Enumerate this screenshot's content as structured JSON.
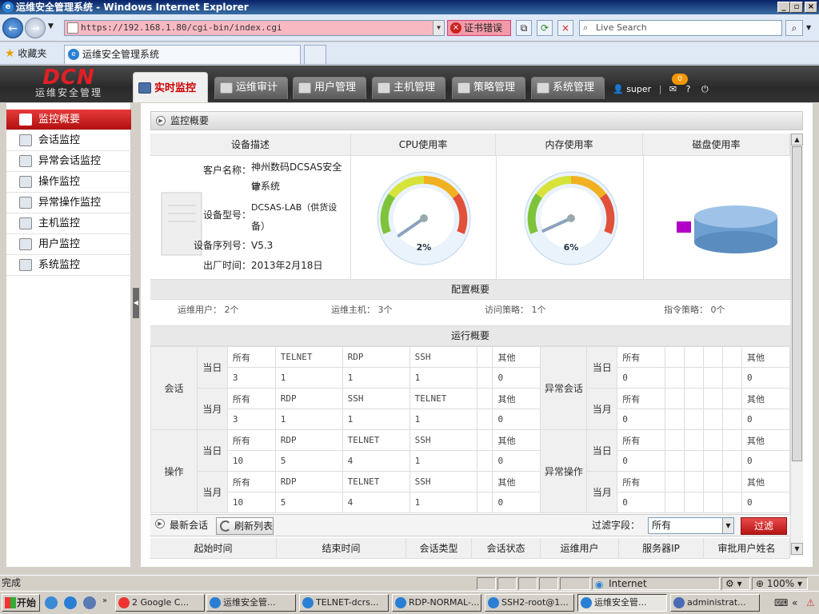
{
  "window": {
    "title": "运维安全管理系统 - Windows Internet Explorer"
  },
  "browser": {
    "address": "https://192.168.1.80/cgi-bin/index.cgi",
    "cert_error": "证书错误",
    "search_placeholder": "Live Search",
    "favorites": "收藏夹",
    "tab_title": "运维安全管理系统"
  },
  "app": {
    "logo_main": "DCN",
    "logo_sub": "运维安全管理",
    "tabs": [
      {
        "label": "实时监控"
      },
      {
        "label": "运维审计"
      },
      {
        "label": "用户管理"
      },
      {
        "label": "主机管理"
      },
      {
        "label": "策略管理"
      },
      {
        "label": "系统管理"
      }
    ],
    "user": "super",
    "message_count": "0",
    "help": "?",
    "logout": "⏻"
  },
  "sidebar": {
    "items": [
      {
        "label": "监控概要",
        "icon": "overview-icon"
      },
      {
        "label": "会话监控",
        "icon": "session-icon"
      },
      {
        "label": "异常会话监控",
        "icon": "alert-session-icon"
      },
      {
        "label": "操作监控",
        "icon": "operation-icon"
      },
      {
        "label": "异常操作监控",
        "icon": "alert-operation-icon"
      },
      {
        "label": "主机监控",
        "icon": "host-icon"
      },
      {
        "label": "用户监控",
        "icon": "user-icon"
      },
      {
        "label": "系统监控",
        "icon": "system-icon"
      }
    ]
  },
  "main": {
    "breadcrumb": "监控概要",
    "headers": {
      "device": "设备描述",
      "cpu": "CPU使用率",
      "mem": "内存使用率",
      "disk": "磁盘使用率"
    },
    "device": {
      "customer_label": "客户名称：",
      "customer_line1": "神州数码DCSAS安全审",
      "customer_line2": "计系统",
      "model_label": "设备型号：",
      "model_line1": "DCSAS-LAB（供货设",
      "model_line2": "备）",
      "serial_label": "设备序列号：",
      "serial": "V5.3",
      "date_label": "出厂时间：",
      "date": "2013年2月18日"
    },
    "cpu": {
      "value": 2,
      "text": "2%"
    },
    "mem": {
      "value": 6,
      "text": "6%"
    },
    "config": {
      "title": "配置概要",
      "items": [
        "运维用户： 2个",
        "运维主机： 3个",
        "访问策略： 1个",
        "指令策略： 0个"
      ]
    },
    "runtime": {
      "title": "运行概要",
      "session": "会话",
      "operation": "操作",
      "abnormal_session": "异常会话",
      "abnormal_operation": "异常操作",
      "today": "当日",
      "month": "当月",
      "left_rows": [
        {
          "h": [
            "所有",
            "TELNET",
            "RDP",
            "SSH",
            "",
            "其他"
          ],
          "v": [
            "3",
            "1",
            "1",
            "1",
            "",
            "0"
          ]
        },
        {
          "h": [
            "所有",
            "RDP",
            "SSH",
            "TELNET",
            "",
            "其他"
          ],
          "v": [
            "3",
            "1",
            "1",
            "1",
            "",
            "0"
          ]
        },
        {
          "h": [
            "所有",
            "RDP",
            "TELNET",
            "SSH",
            "",
            "其他"
          ],
          "v": [
            "10",
            "5",
            "4",
            "1",
            "",
            "0"
          ]
        },
        {
          "h": [
            "所有",
            "RDP",
            "TELNET",
            "SSH",
            "",
            "其他"
          ],
          "v": [
            "10",
            "5",
            "4",
            "1",
            "",
            "0"
          ]
        }
      ],
      "right_rows": [
        {
          "h": [
            "所有",
            "",
            "",
            "",
            "",
            "其他"
          ],
          "v": [
            "0",
            "",
            "",
            "",
            "",
            "0"
          ]
        },
        {
          "h": [
            "所有",
            "",
            "",
            "",
            "",
            "其他"
          ],
          "v": [
            "0",
            "",
            "",
            "",
            "",
            "0"
          ]
        },
        {
          "h": [
            "所有",
            "",
            "",
            "",
            "",
            "其他"
          ],
          "v": [
            "0",
            "",
            "",
            "",
            "",
            "0"
          ]
        },
        {
          "h": [
            "所有",
            "",
            "",
            "",
            "",
            "其他"
          ],
          "v": [
            "0",
            "",
            "",
            "",
            "",
            "0"
          ]
        }
      ]
    },
    "sessions": {
      "title": "最新会话",
      "refresh": "刷新列表",
      "filter_label": "过滤字段：",
      "filter_value": "所有",
      "filter_button": "过滤",
      "columns": [
        "起始时间",
        "结束时间",
        "会话类型",
        "会话状态",
        "运维用户",
        "服务器IP",
        "审批用户姓名"
      ]
    }
  },
  "statusbar": {
    "text": "完成",
    "zone": "Internet",
    "zoom": "100%"
  },
  "taskbar": {
    "start": "开始",
    "items": [
      "2 Google C...",
      "运维安全管...",
      "TELNET-dcrs...",
      "RDP-NORMAL-...",
      "SSH2-root@1...",
      "运维安全管...",
      "administrat..."
    ]
  }
}
